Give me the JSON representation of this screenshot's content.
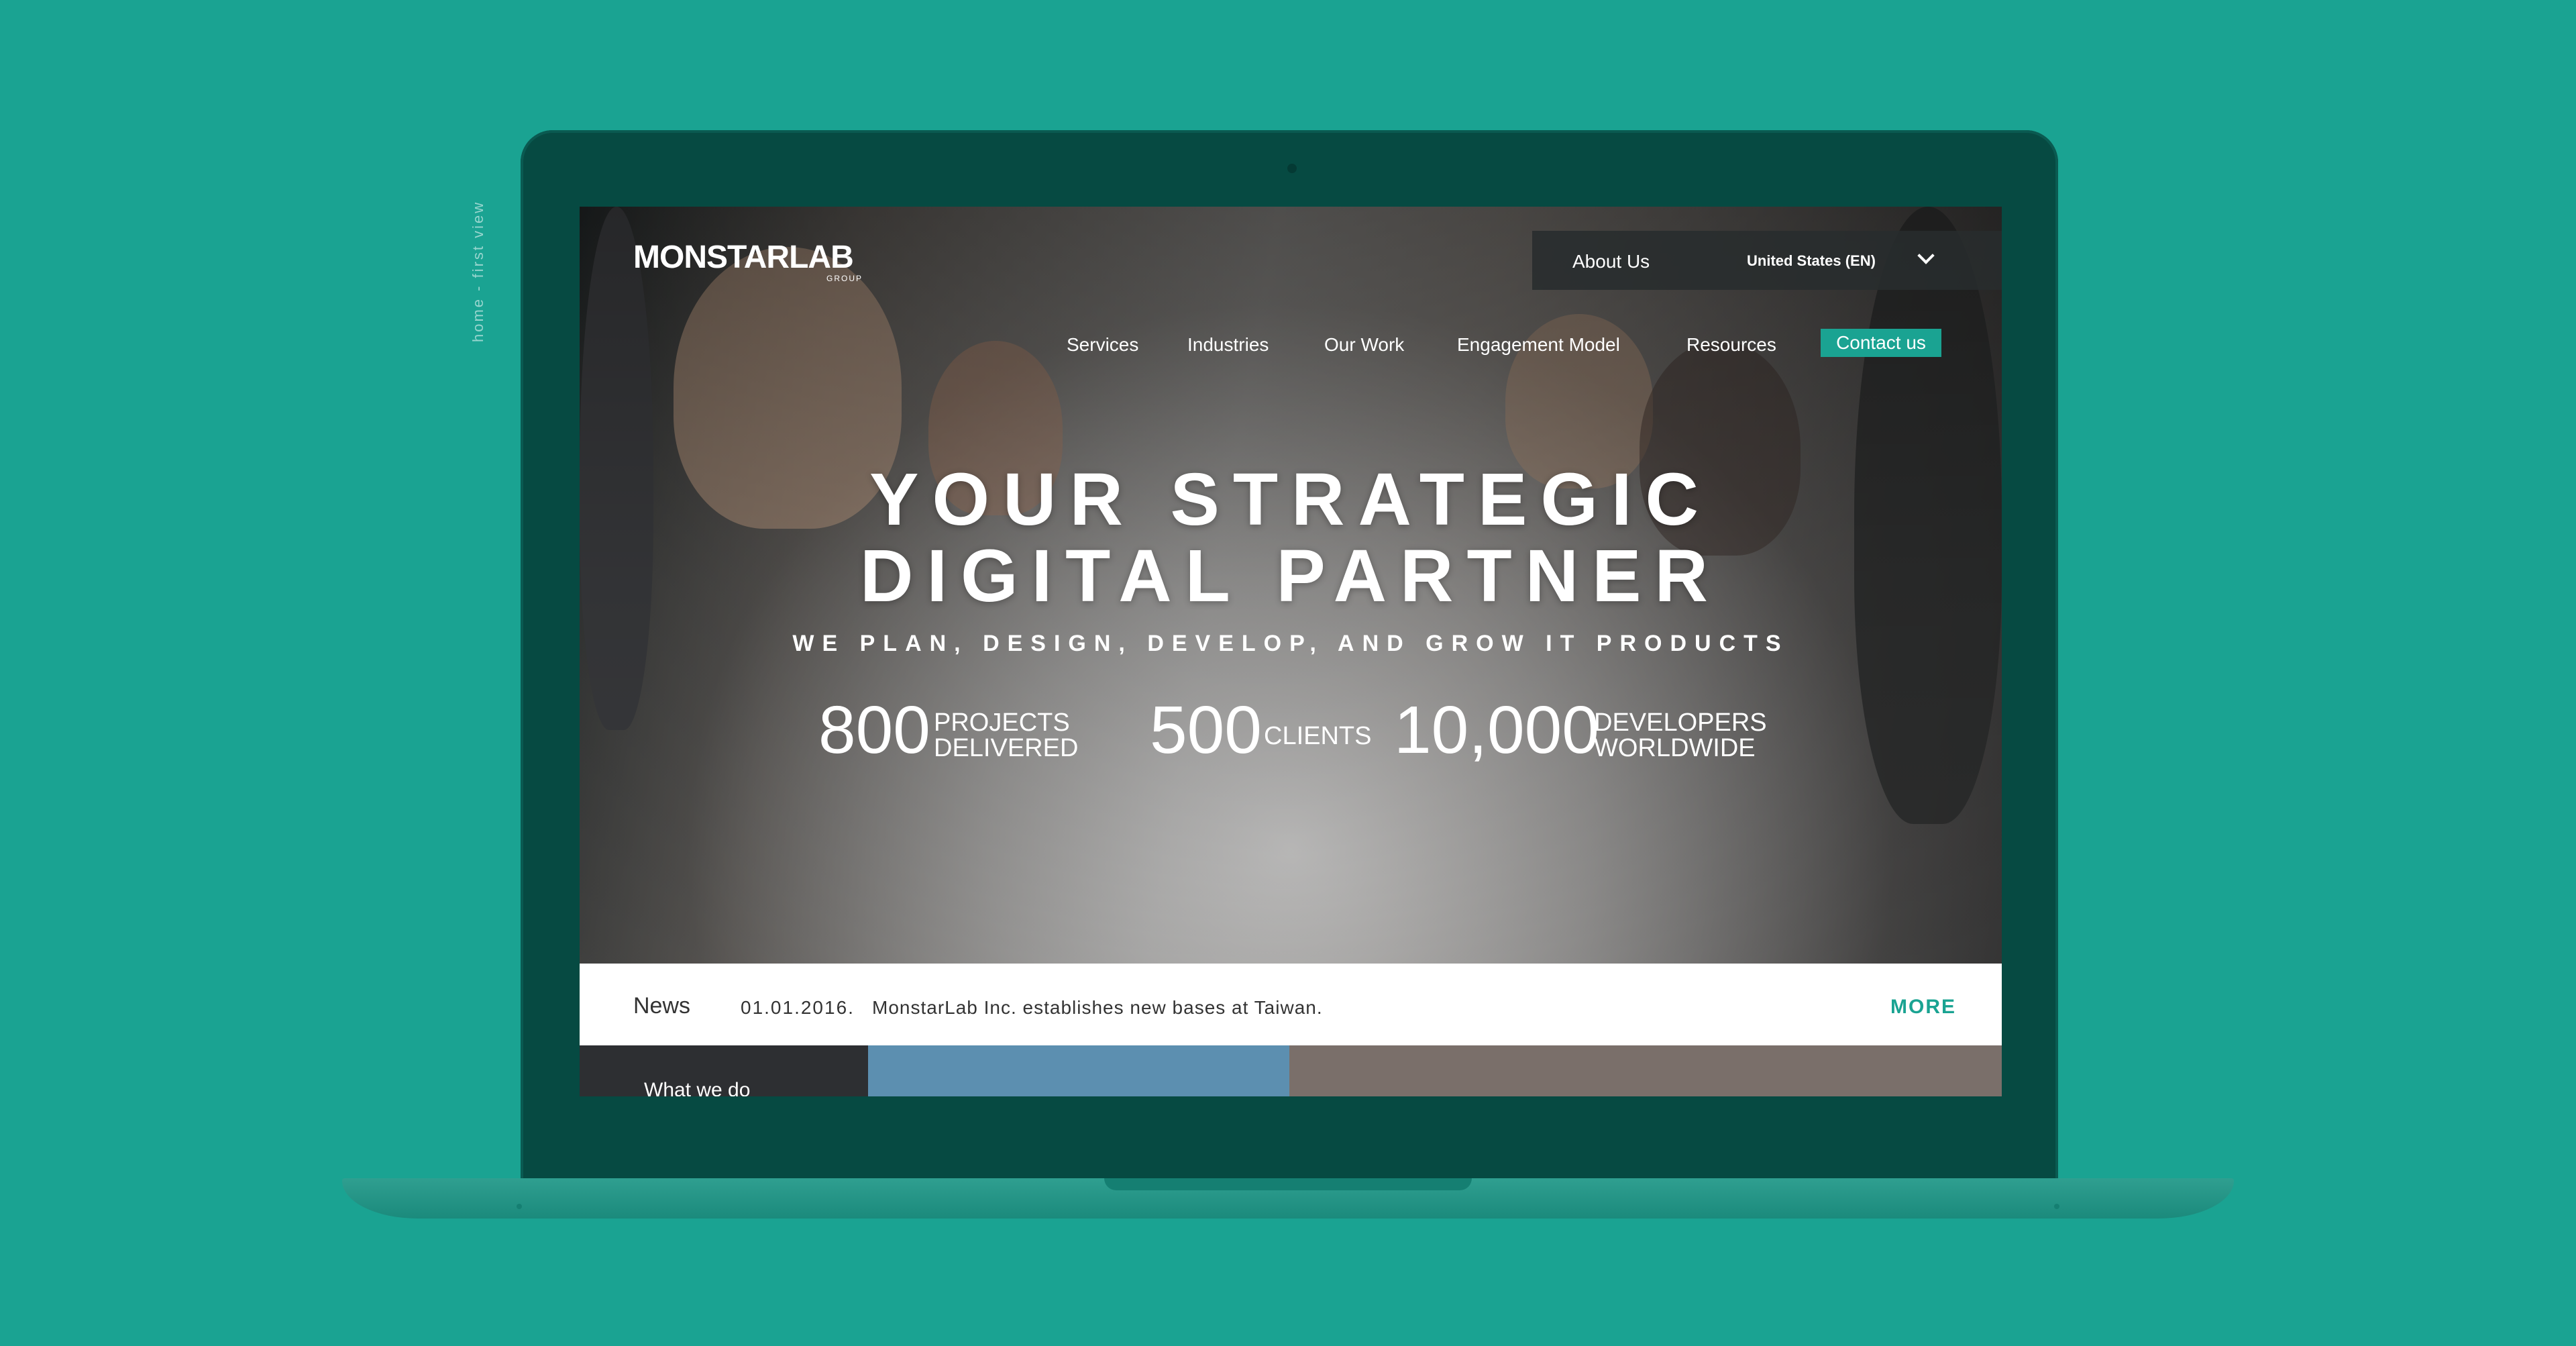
{
  "caption": "home - first view",
  "brand": {
    "logo_text": "MONSTARLAB",
    "logo_sub": "GROUP",
    "accent": "#1aa392"
  },
  "topbar": {
    "about": "About Us",
    "region": "United States (EN)"
  },
  "nav": {
    "items": [
      "Services",
      "Industries",
      "Our Work",
      "Engagement Model",
      "Resources"
    ],
    "contact": "Contact us"
  },
  "hero": {
    "headline_1": "YOUR STRATEGIC",
    "headline_2": "DIGITAL PARTNER",
    "subline": "WE PLAN, DESIGN, DEVELOP, AND GROW IT PRODUCTS",
    "stats": [
      {
        "number": "800",
        "label_1": "PROJECTS",
        "label_2": "DELIVERED"
      },
      {
        "number": "500",
        "label_1": "CLIENTS",
        "label_2": ""
      },
      {
        "number": "10,000",
        "label_1": "DEVELOPERS",
        "label_2": "WORLDWIDE"
      }
    ]
  },
  "news": {
    "title": "News",
    "date": "01.01.2016.",
    "text": "MonstarLab Inc. establishes new bases at Taiwan.",
    "more": "MORE"
  },
  "strip": {
    "what_we_do": "What we do"
  }
}
